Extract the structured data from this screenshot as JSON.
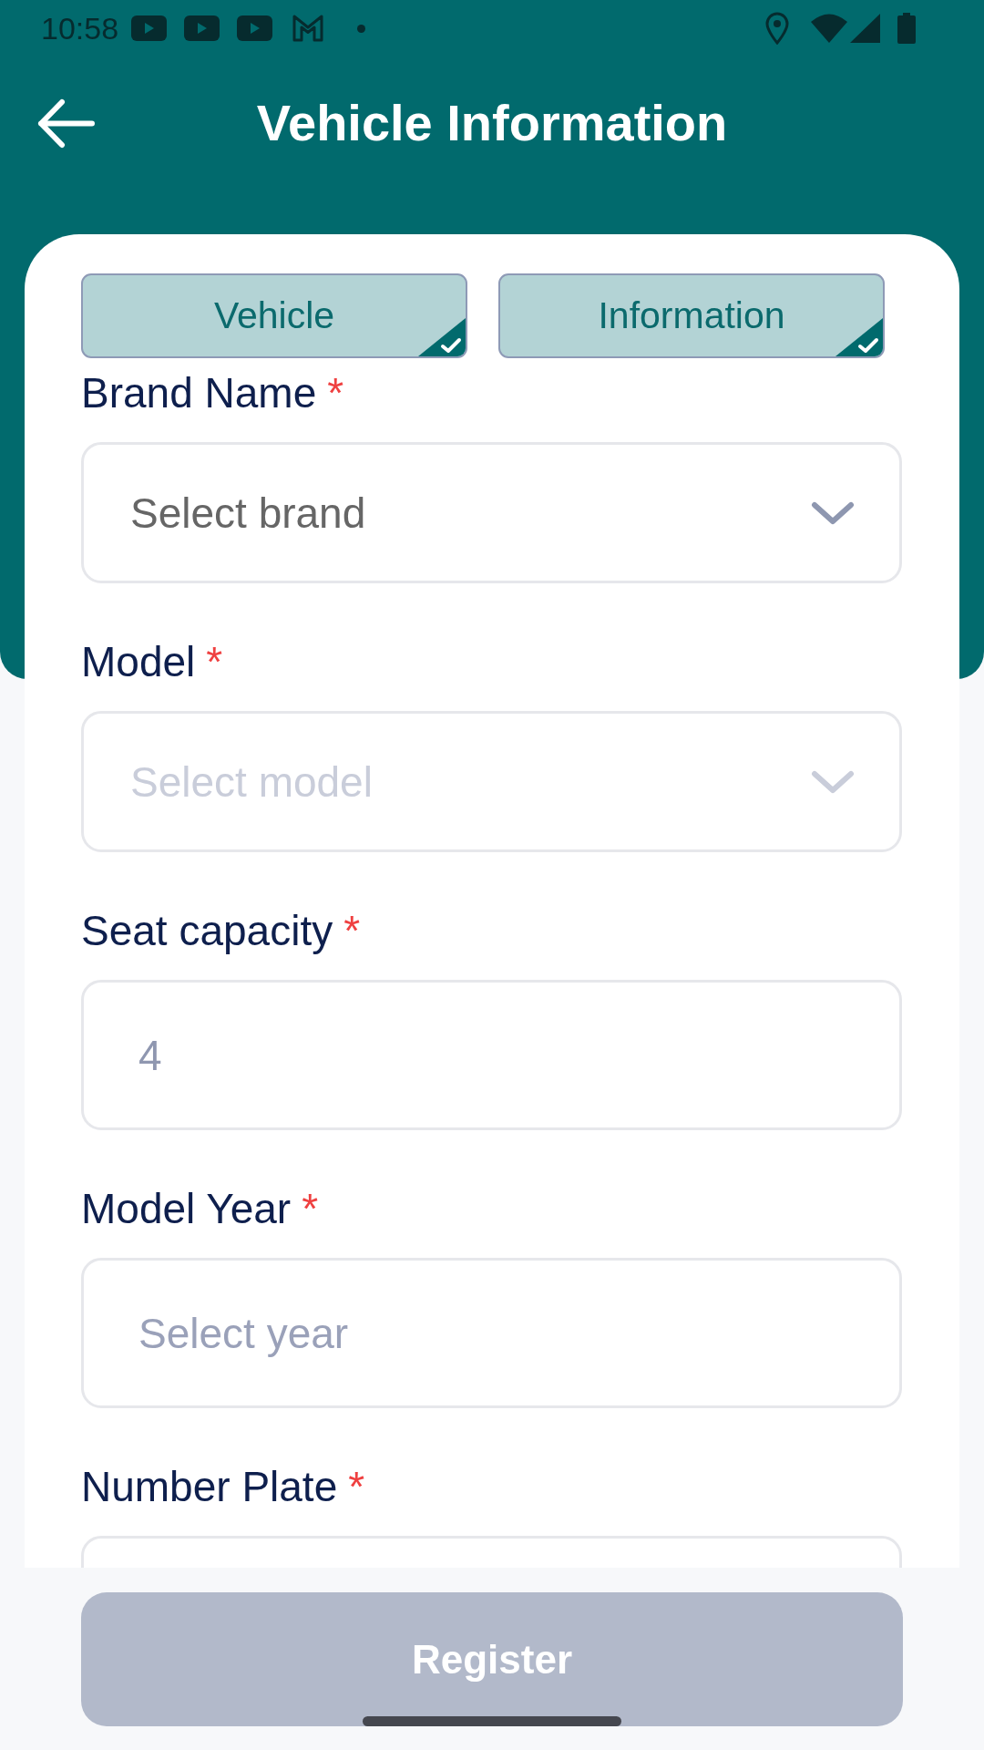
{
  "status_bar": {
    "time": "10:58"
  },
  "app_bar": {
    "title": "Vehicle Information"
  },
  "steps": [
    {
      "label": "Vehicle",
      "completed": true
    },
    {
      "label": "Information",
      "completed": true
    }
  ],
  "form": {
    "fields": [
      {
        "kind": "select",
        "label": "Brand Name",
        "required_mark": "*",
        "placeholder": "Select brand",
        "disabled": false
      },
      {
        "kind": "select",
        "label": "Model",
        "required_mark": "*",
        "placeholder": "Select model",
        "disabled": true
      },
      {
        "kind": "input",
        "label": "Seat capacity",
        "required_mark": "*",
        "value": "4",
        "disabled": false
      },
      {
        "kind": "input",
        "label": "Model Year",
        "required_mark": "*",
        "placeholder": "Select year",
        "disabled": false
      },
      {
        "kind": "input",
        "label": "Number Plate",
        "required_mark": "*",
        "disabled": false
      }
    ]
  },
  "register_button": {
    "label": "Register",
    "disabled": true
  }
}
